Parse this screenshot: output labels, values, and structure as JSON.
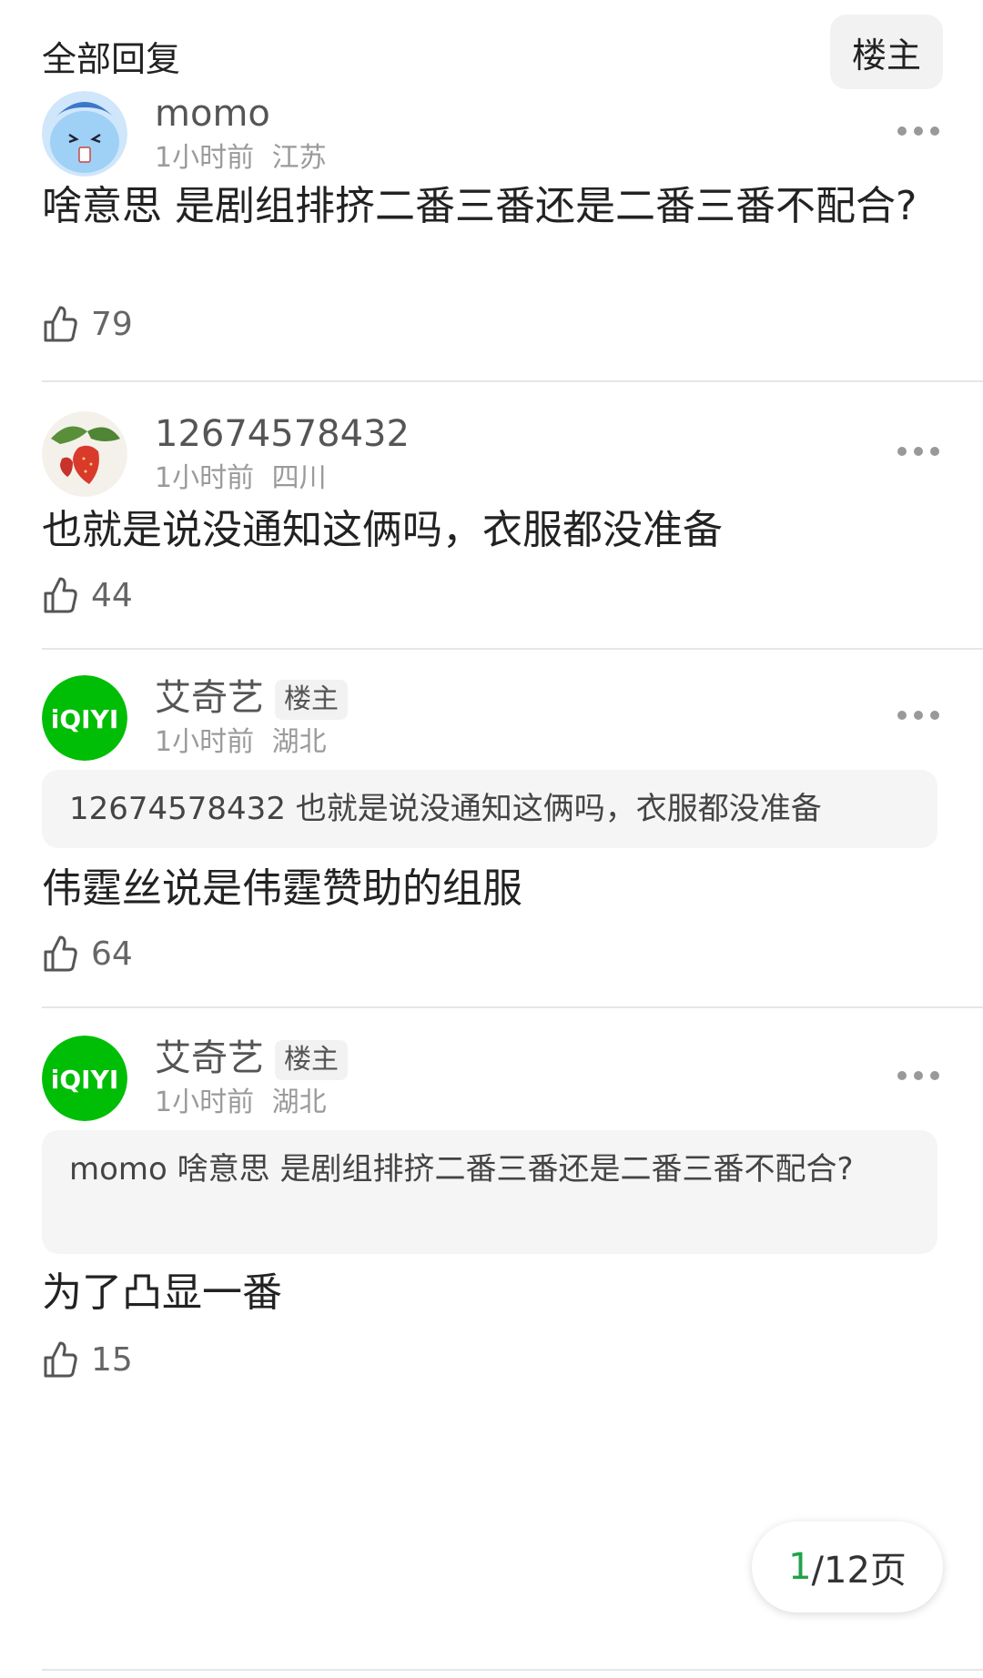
{
  "header": {
    "title": "全部回复",
    "owner_filter": "楼主"
  },
  "comments": [
    {
      "username": "momo",
      "badge": "",
      "time": "1小时前",
      "location": "江苏",
      "quote": "",
      "text": "啥意思 是剧组排挤二番三番还是二番三番不配合?",
      "likes": "79",
      "avatar_icon": "cartoon-blue-avatar"
    },
    {
      "username": "12674578432",
      "badge": "",
      "time": "1小时前",
      "location": "四川",
      "quote": "",
      "text": "也就是说没通知这俩吗，衣服都没准备",
      "likes": "44",
      "avatar_icon": "strawberry-avatar"
    },
    {
      "username": "艾奇艺",
      "badge": "楼主",
      "time": "1小时前",
      "location": "湖北",
      "quote": "12674578432 也就是说没通知这俩吗，衣服都没准备",
      "text": "伟霆丝说是伟霆赞助的组服",
      "likes": "64",
      "avatar_icon": "iqiyi-logo-avatar"
    },
    {
      "username": "艾奇艺",
      "badge": "楼主",
      "time": "1小时前",
      "location": "湖北",
      "quote": "momo 啥意思 是剧组排挤二番三番还是二番三番不配合?",
      "text": "为了凸显一番",
      "likes": "15",
      "avatar_icon": "iqiyi-logo-avatar"
    }
  ],
  "pager": {
    "current": "1",
    "rest": "/12页"
  },
  "colors": {
    "iqiyi_green": "#00be06",
    "page_current": "#1fa34a"
  },
  "avatar_logo_text": "iQIYI"
}
